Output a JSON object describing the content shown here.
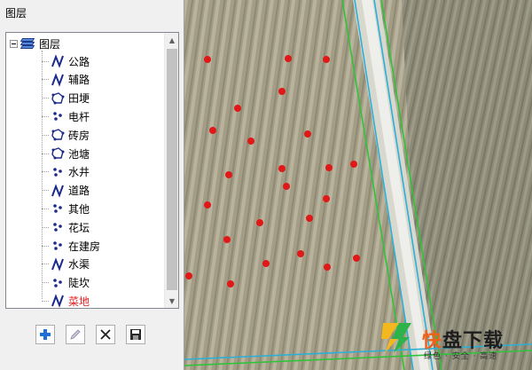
{
  "panel": {
    "title": "图层",
    "root_label": "图层",
    "layers": [
      {
        "label": "公路",
        "icon": "line-layer-icon",
        "color": "#000000"
      },
      {
        "label": "辅路",
        "icon": "line-layer-icon",
        "color": "#000000"
      },
      {
        "label": "田埂",
        "icon": "polygon-layer-icon",
        "color": "#000000"
      },
      {
        "label": "电杆",
        "icon": "point-layer-icon",
        "color": "#000000"
      },
      {
        "label": "砖房",
        "icon": "polygon-layer-icon",
        "color": "#000000"
      },
      {
        "label": "池塘",
        "icon": "polygon-layer-icon",
        "color": "#000000"
      },
      {
        "label": "水井",
        "icon": "point-layer-icon",
        "color": "#000000"
      },
      {
        "label": "道路",
        "icon": "line-layer-icon",
        "color": "#000000"
      },
      {
        "label": "其他",
        "icon": "point-layer-icon",
        "color": "#000000"
      },
      {
        "label": "花坛",
        "icon": "point-layer-icon",
        "color": "#000000"
      },
      {
        "label": "在建房",
        "icon": "point-layer-icon",
        "color": "#000000"
      },
      {
        "label": "水渠",
        "icon": "line-layer-icon",
        "color": "#000000"
      },
      {
        "label": "陡坎",
        "icon": "point-layer-icon",
        "color": "#000000"
      },
      {
        "label": "菜地",
        "icon": "line-layer-icon",
        "color": "#e02020"
      }
    ]
  },
  "toolbar": {
    "buttons": [
      "add-icon",
      "edit-icon",
      "delete-icon",
      "save-icon"
    ]
  },
  "watermark": {
    "brand": "快盘下载",
    "brand_first": "快",
    "brand_rest": "盘下载",
    "tagline": "绿色 · 安全 · 高速"
  },
  "colors": {
    "point_marker": "#e01818",
    "road_line": "#2ec43a",
    "canal_line": "#2ab0d8"
  }
}
